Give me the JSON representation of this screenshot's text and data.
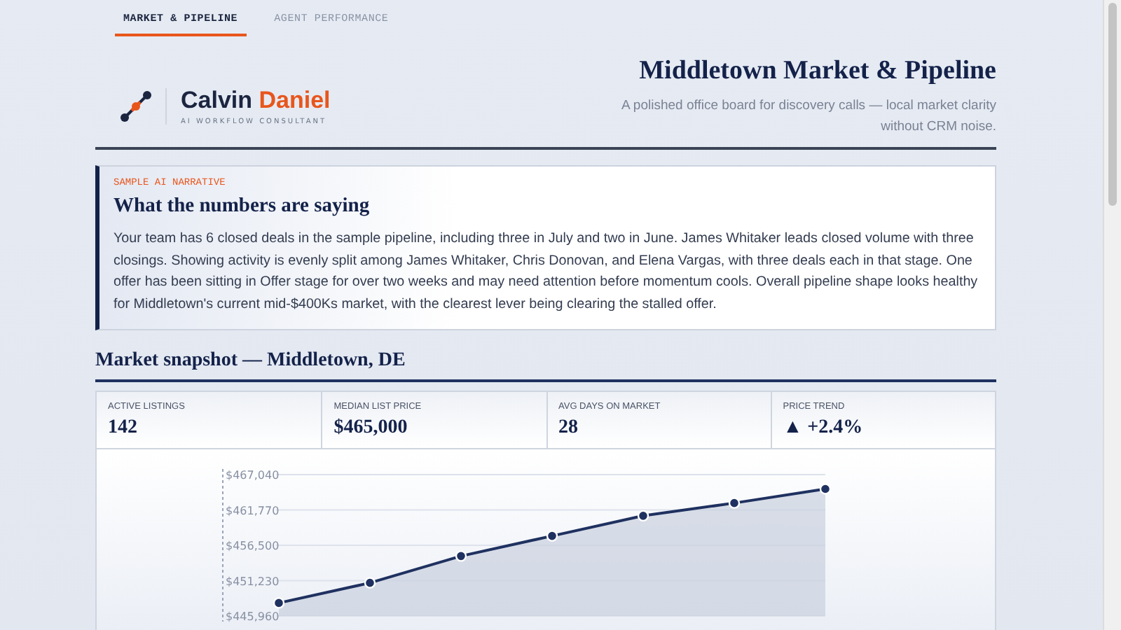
{
  "tabs": [
    {
      "label": "MARKET & PIPELINE",
      "selected": true
    },
    {
      "label": "AGENT PERFORMANCE",
      "selected": false
    }
  ],
  "brand": {
    "first_name": "Calvin",
    "last_name": "Daniel",
    "tagline": "AI WORKFLOW CONSULTANT"
  },
  "header": {
    "title": "Middletown Market & Pipeline",
    "subtitle": "A polished office board for discovery calls — local market clarity without CRM noise."
  },
  "narrative": {
    "eyebrow": "SAMPLE AI NARRATIVE",
    "title": "What the numbers are saying",
    "body": "Your team has 6 closed deals in the sample pipeline, including three in July and two in June. James Whitaker leads closed volume with three closings. Showing activity is evenly split among James Whitaker, Chris Donovan, and Elena Vargas, with three deals each in that stage. One offer has been sitting in Offer stage for over two weeks and may need attention before momentum cools. Overall pipeline shape looks healthy for Middletown's current mid-$400Ks market, with the clearest lever being clearing the stalled offer."
  },
  "snapshot": {
    "title": "Market snapshot — Middletown, DE",
    "stats": [
      {
        "label": "ACTIVE LISTINGS",
        "value": "142"
      },
      {
        "label": "MEDIAN LIST PRICE",
        "value": "$465,000"
      },
      {
        "label": "AVG DAYS ON MARKET",
        "value": "28"
      },
      {
        "label": "PRICE TREND",
        "value": "▲ +2.4%"
      }
    ],
    "chart_data": {
      "type": "area",
      "grid": true,
      "series": [
        {
          "color": "#1f3160",
          "values": [
            447900,
            450900,
            454900,
            457900,
            460900,
            462800,
            464900
          ]
        }
      ],
      "ylim": [
        445960,
        467040
      ],
      "yticks": [
        {
          "value": 445960,
          "label": "$445,960"
        },
        {
          "value": 451230,
          "label": "$451,230"
        },
        {
          "value": 456500,
          "label": "$456,500"
        },
        {
          "value": 461770,
          "label": "$461,770"
        },
        {
          "value": 467040,
          "label": "$467,040"
        }
      ]
    }
  }
}
